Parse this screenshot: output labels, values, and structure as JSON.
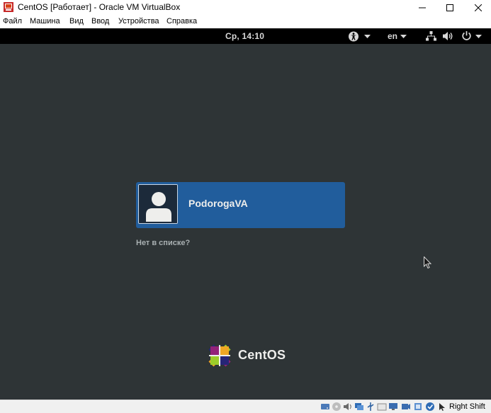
{
  "window": {
    "title": "CentOS [Работает] - Oracle VM VirtualBox"
  },
  "menu": [
    "Файл",
    "Машина",
    "Вид",
    "Ввод",
    "Устройства",
    "Справка"
  ],
  "guest": {
    "clock": "Ср, 14:10",
    "language": "en",
    "user_name": "PodorogaVA",
    "not_listed": "Нет в списке?",
    "logo_text": "CentOS"
  },
  "statusbar": {
    "host_key": "Right Shift",
    "icons": [
      "harddisk-icon",
      "optical-disk-icon",
      "audio-icon",
      "network-icon",
      "usb-icon",
      "shared-folders-icon",
      "display-icon",
      "video-capture-icon",
      "cpu-icon",
      "mouse-integration-icon",
      "arrow-icon"
    ]
  },
  "colors": {
    "guest_bg": "#2e3436",
    "topbar": "#000000",
    "user_card": "#215d9c"
  }
}
